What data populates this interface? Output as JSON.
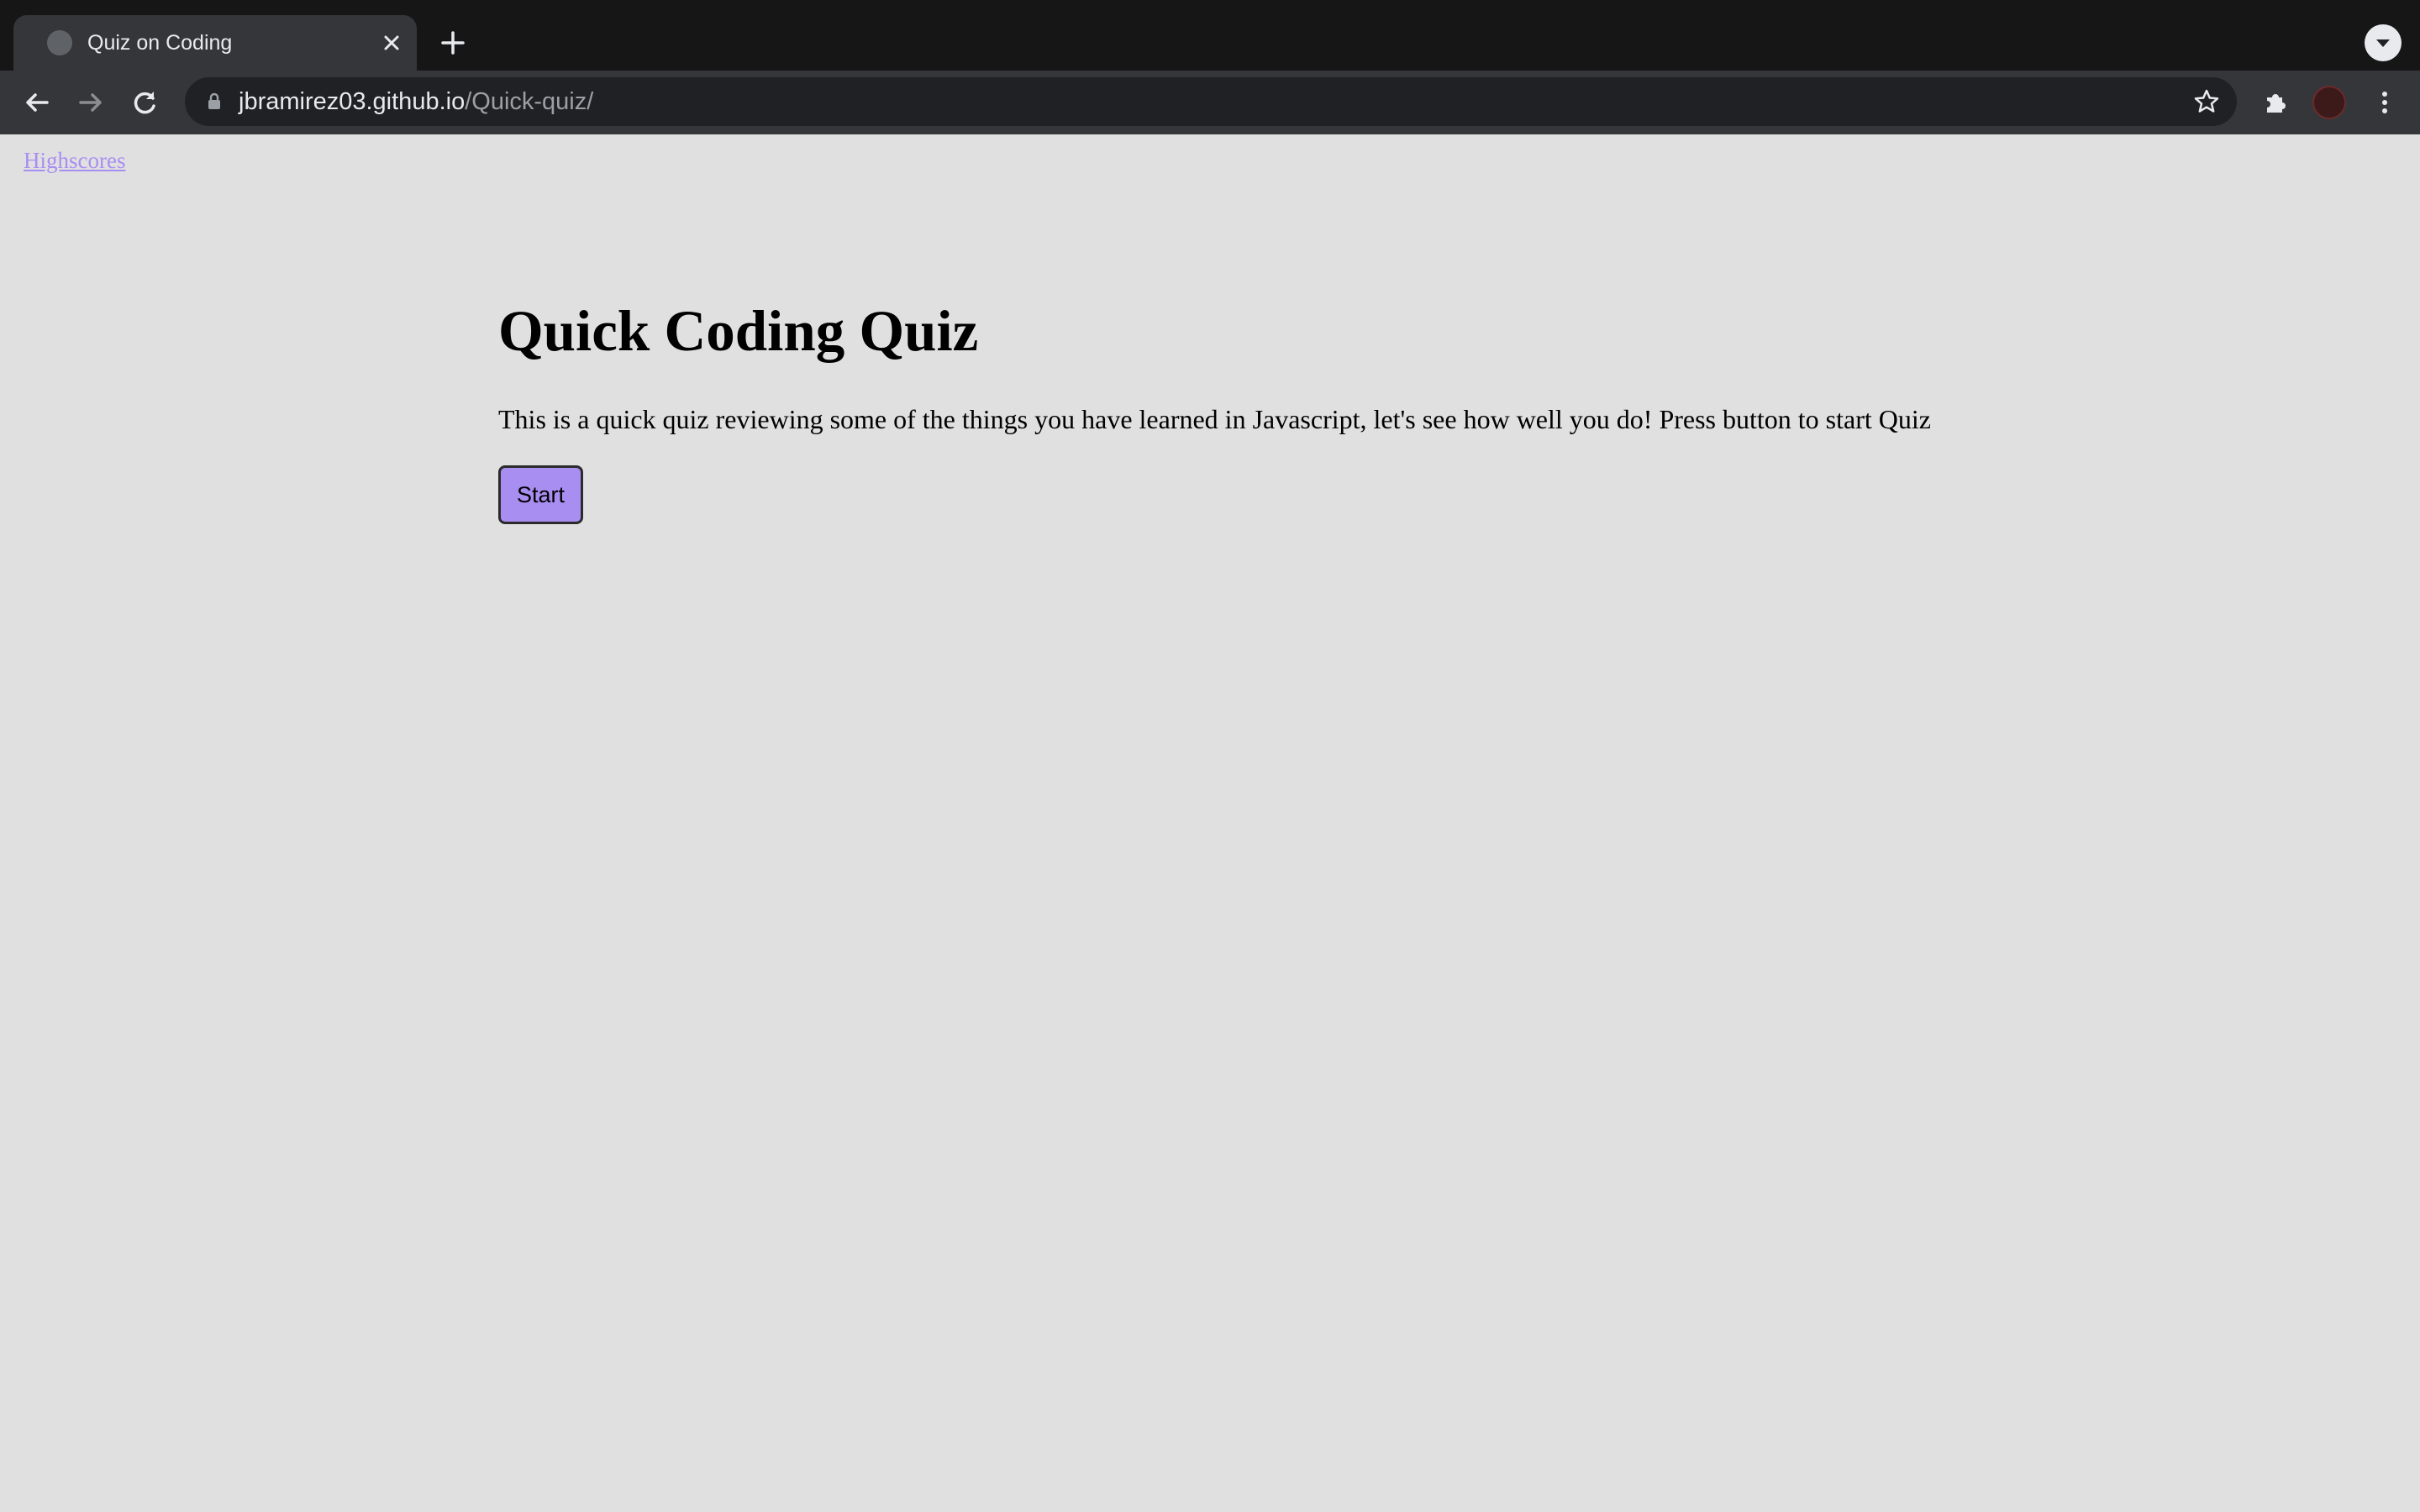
{
  "browser": {
    "tab": {
      "title": "Quiz on Coding"
    },
    "address_bar": {
      "host": "jbramirez03.github.io",
      "path": "/Quick-quiz/"
    },
    "icons": {
      "tab_favicon": "globe-icon",
      "tab_close": "close-icon",
      "new_tab": "plus-icon",
      "tab_search": "chevron-down-icon",
      "back": "arrow-left-icon",
      "forward": "arrow-right-icon",
      "reload": "reload-icon",
      "lock": "lock-icon",
      "bookmark": "star-icon",
      "extensions": "puzzle-icon",
      "profile": "avatar",
      "menu": "kebab-menu-icon"
    }
  },
  "page": {
    "highscores_link": "Highscores",
    "title": "Quick Coding Quiz",
    "description": "This is a quick quiz reviewing some of the things you have learned in Javascript, let's see how well you do! Press button to start Quiz",
    "start_button": "Start"
  },
  "colors": {
    "page_background": "#e0e0e0",
    "accent_purple": "#a98ef2",
    "chrome_dark": "#202124",
    "toolbar": "#35363a"
  }
}
